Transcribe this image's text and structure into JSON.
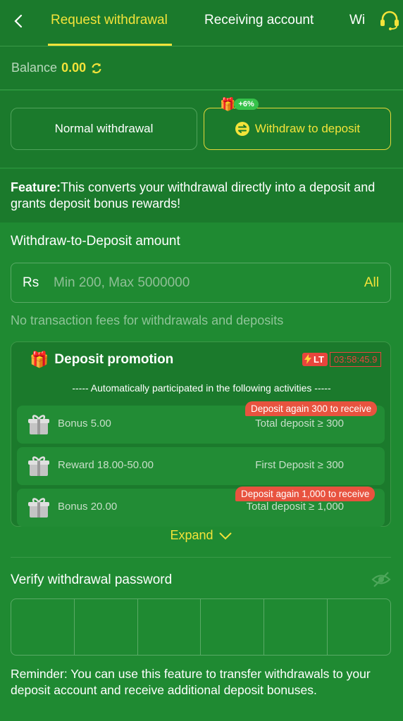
{
  "header": {
    "tabs": [
      {
        "label": "Request withdrawal",
        "active": true
      },
      {
        "label": "Receiving account",
        "active": false
      },
      {
        "label": "Wi",
        "active": false
      }
    ]
  },
  "balance": {
    "label": "Balance",
    "value": "0.00"
  },
  "mode": {
    "normal_label": "Normal withdrawal",
    "deposit_label": "Withdraw to deposit",
    "bonus_badge": "+6%"
  },
  "feature": {
    "title": "Feature:",
    "text": "This converts your withdrawal directly into a deposit and grants deposit bonus rewards!"
  },
  "amount": {
    "label": "Withdraw-to-Deposit amount",
    "currency": "Rs",
    "placeholder": "Min 200, Max 5000000",
    "all_label": "All",
    "fee_note": "No transaction fees for withdrawals and deposits"
  },
  "promotion": {
    "title": "Deposit promotion",
    "lt_badge": "LT",
    "timer": "03:58:45.9",
    "subtitle": "----- Automatically participated in the following activities -----",
    "items": [
      {
        "name": "Bonus 5.00",
        "condition": "Total deposit ≥ 300",
        "tag": "Deposit again 300 to receive"
      },
      {
        "name": "Reward 18.00-50.00",
        "condition": "First Deposit ≥ 300",
        "tag": ""
      },
      {
        "name": "Bonus 20.00",
        "condition": "Total deposit ≥ 1,000",
        "tag": "Deposit again 1,000 to receive"
      }
    ],
    "expand_label": "Expand"
  },
  "password": {
    "label": "Verify withdrawal password"
  },
  "reminder": "Reminder: You can use this feature to transfer withdrawals to your deposit account and receive additional deposit bonuses.",
  "colors": {
    "background": "#1f8a32",
    "panel": "#1b7a2c",
    "accent": "#f3e33a",
    "alert": "#e8453c"
  }
}
